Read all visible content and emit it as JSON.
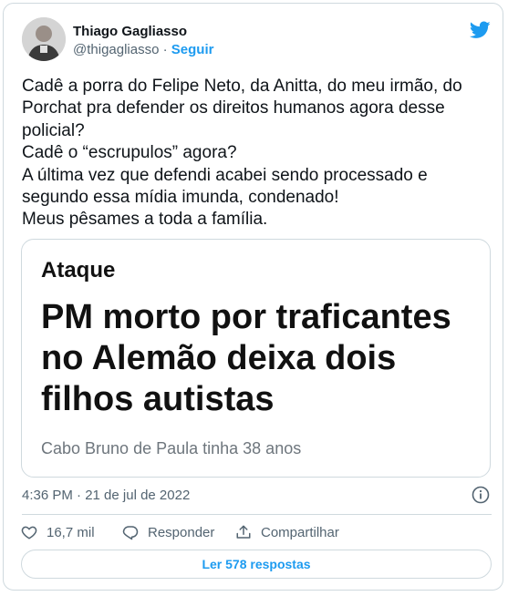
{
  "tweet": {
    "author_name": "Thiago Gagliasso",
    "handle": "@thigagliasso",
    "separator": "·",
    "follow_label": "Seguir",
    "text_lines": [
      "Cadê  a porra do Felipe Neto, da Anitta, do meu irmão, do",
      "Porchat pra defender os direitos humanos agora desse",
      "policial?",
      "Cadê o “escrupulos” agora?",
      "A última vez que defendi acabei sendo processado e",
      "segundo essa mídia imunda, condenado!",
      "Meus pêsames a toda a família."
    ],
    "timestamp": "4:36 PM · 21 de jul de 2022"
  },
  "embed": {
    "kicker": "Ataque",
    "title_lines": [
      "PM morto por traficantes",
      "no Alemão deixa dois",
      "filhos autistas"
    ],
    "subtitle": "Cabo Bruno de Paula tinha 38 anos"
  },
  "actions": {
    "likes": "16,7 mil",
    "reply_label": "Responder",
    "share_label": "Compartilhar"
  },
  "read_replies_label": "Ler 578 respostas",
  "colors": {
    "accent": "#1d9bf0",
    "text": "#0f1419",
    "secondary": "#536471",
    "border": "#cfd9de"
  },
  "icons": [
    "twitter-bird-icon",
    "info-icon",
    "heart-icon",
    "reply-icon",
    "share-icon"
  ]
}
